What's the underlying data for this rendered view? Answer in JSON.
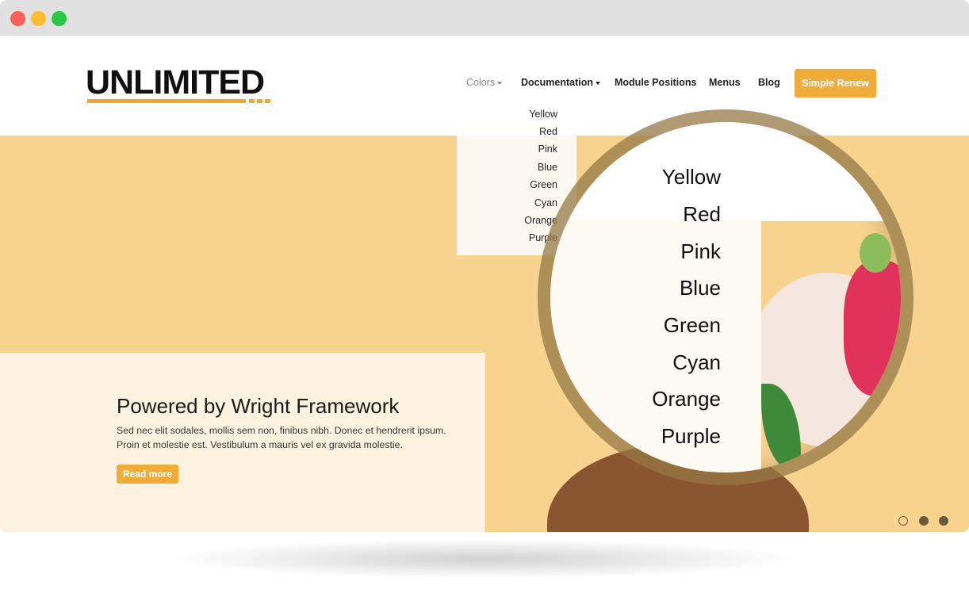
{
  "window": {
    "controls": [
      {
        "name": "close",
        "color": "#fe5f57"
      },
      {
        "name": "minimize",
        "color": "#febc2e"
      },
      {
        "name": "maximize",
        "color": "#28c840"
      }
    ]
  },
  "brand": {
    "logo": "UNLIMITED",
    "accent": "#efac38"
  },
  "nav": {
    "items": [
      {
        "label": "Colors",
        "dropdown": true,
        "active": true
      },
      {
        "label": "Documentation",
        "dropdown": true
      },
      {
        "label": "Module Positions"
      },
      {
        "label": "Menus"
      },
      {
        "label": "Blog"
      }
    ],
    "cta": "Simple Renew"
  },
  "dropdown": {
    "items": [
      "Yellow",
      "Red",
      "Pink",
      "Blue",
      "Green",
      "Cyan",
      "Orange",
      "Purple"
    ]
  },
  "hero": {
    "title": "Powered by Wright Framework",
    "text": "Sed nec elit sodales, mollis sem non, finibus nibh. Donec et hendrerit ipsum. Proin et molestie est. Vestibulum a mauris vel ex gravida molestie.",
    "button": "Read more",
    "slides": 3,
    "active_slide": 1
  }
}
